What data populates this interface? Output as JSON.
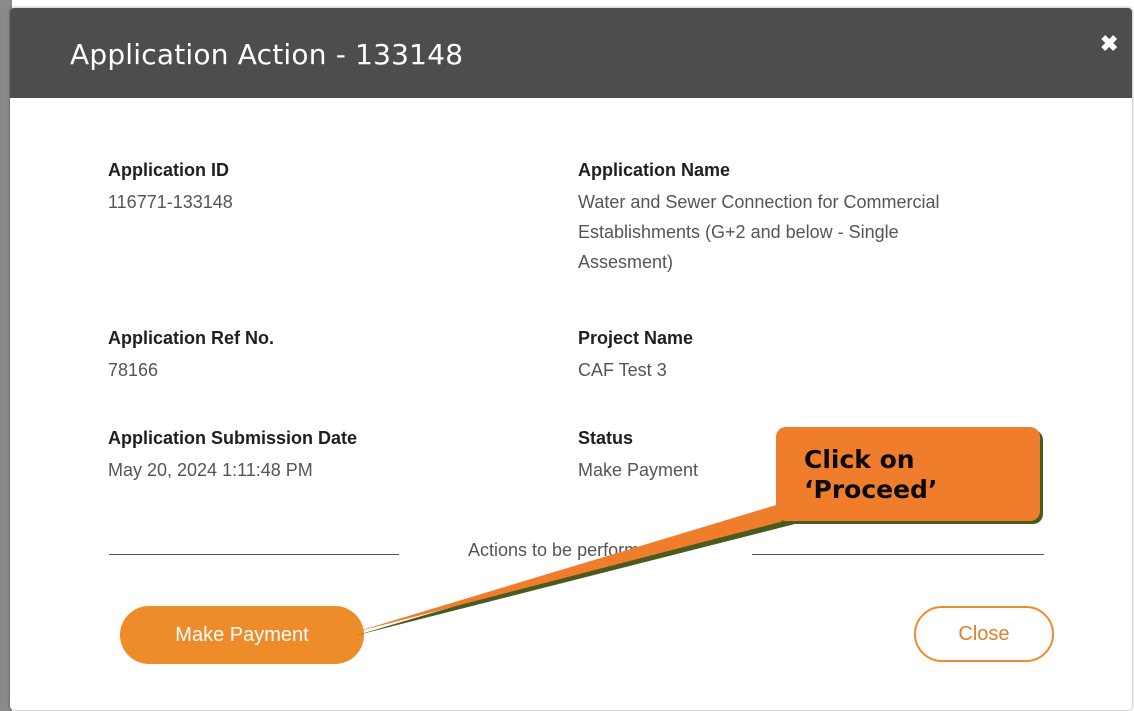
{
  "modal": {
    "title": "Application Action - 133148",
    "close_glyph": "✖"
  },
  "details": {
    "application_id": {
      "label": "Application ID",
      "value": "116771-133148"
    },
    "application_name": {
      "label": "Application Name",
      "value_lines": [
        "Water and Sewer Connection for Commercial",
        "Establishments (G+2 and below - Single",
        "Assesment)"
      ]
    },
    "application_ref": {
      "label": "Application Ref No.",
      "value": "78166"
    },
    "project_name": {
      "label": "Project Name",
      "value": "CAF Test 3"
    },
    "submission_date": {
      "label": "Application Submission Date",
      "value": "May 20, 2024 1:11:48 PM"
    },
    "status": {
      "label": "Status",
      "value": "Make Payment"
    }
  },
  "actions": {
    "section_label": "Actions to be performed",
    "make_payment_label": "Make Payment",
    "close_label": "Close"
  },
  "callout": {
    "line1": "Click on",
    "line2": "‘Proceed’"
  },
  "colors": {
    "header_bg": "#4d4d4d",
    "accent_orange": "#ef8c2a",
    "callout_orange": "#f07d2c",
    "callout_shadow": "#4b5a1f"
  }
}
